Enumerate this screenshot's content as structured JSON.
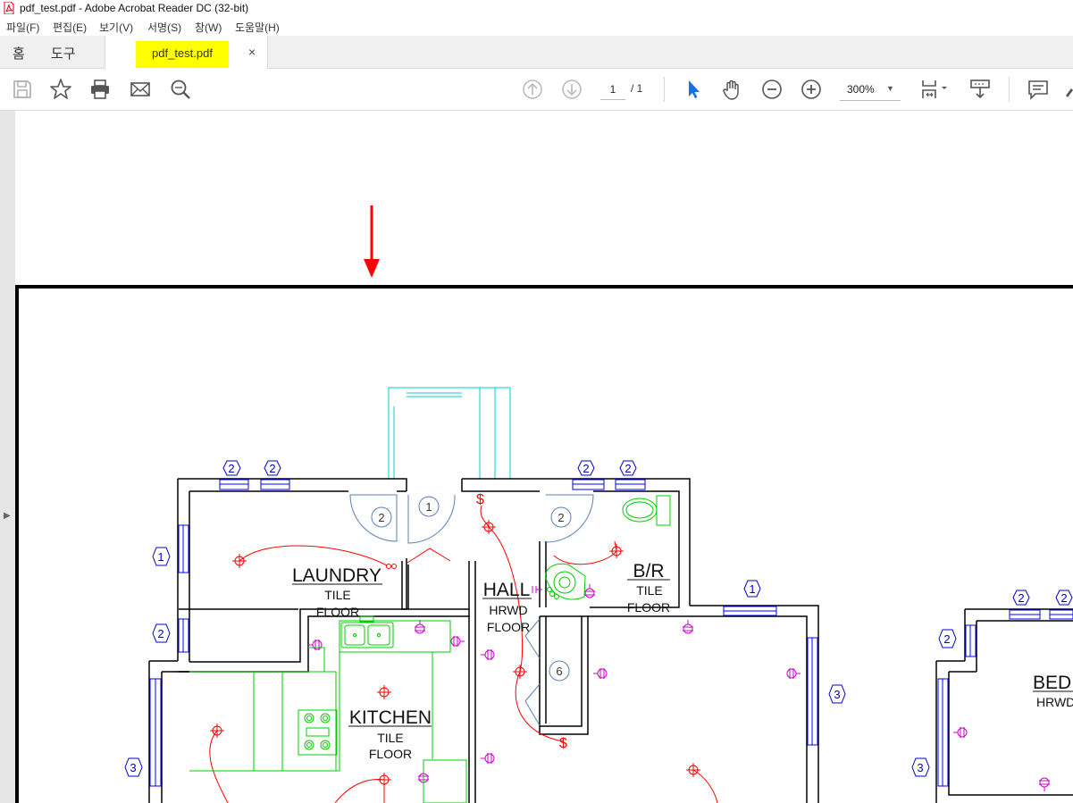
{
  "window": {
    "title": "pdf_test.pdf - Adobe Acrobat Reader DC (32-bit)"
  },
  "menu": [
    "파일(F)",
    "편집(E)",
    "보기(V)",
    "서명(S)",
    "창(W)",
    "도움말(H)"
  ],
  "tabs": {
    "home": "홈",
    "tools": "도구",
    "document": "pdf_test.pdf",
    "close": "×"
  },
  "toolbar": {
    "page_current": "1",
    "page_total": "/ 1",
    "zoom": "300%",
    "icons": [
      "save-icon",
      "star-icon",
      "print-icon",
      "email-icon",
      "find-icon",
      "prev-page-icon",
      "next-page-icon",
      "select-pointer-icon",
      "hand-icon",
      "zoom-out-icon",
      "zoom-in-icon",
      "page-display-icon",
      "scroll-mode-icon",
      "comment-icon"
    ]
  },
  "colors": {
    "highlight": "#ffff00",
    "walls": "#000000",
    "electrical": "#ff0000",
    "fixtures": "#00cc00",
    "windows": "#0000ff",
    "outlets": "#cc00cc",
    "doors": "#5b7fb5",
    "stairs": "#00cccc",
    "arrow": "#ff0000"
  },
  "drawing": {
    "laundry": {
      "name": "LAUNDRY",
      "floor1": "TILE",
      "floor2": "FLOOR"
    },
    "hall": {
      "name": "HALL",
      "floor1": "HRWD",
      "floor2": "FLOOR"
    },
    "bath": {
      "name": "B/R",
      "floor1": "TILE",
      "floor2": "FLOOR"
    },
    "kitchen": {
      "name": "KITCHEN",
      "floor1": "TILE",
      "floor2": "FLOOR"
    },
    "bedroom": {
      "name": "BED",
      "floor1": "HRWD"
    },
    "switch_symbol": "$",
    "tags": {
      "one": "1",
      "two": "2",
      "three": "3",
      "six": "6"
    }
  }
}
